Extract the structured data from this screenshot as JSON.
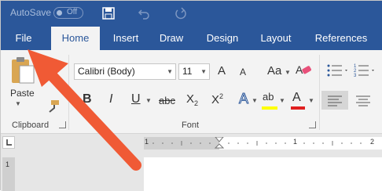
{
  "titlebar": {
    "autosave_label": "AutoSave",
    "autosave_state": "Off",
    "icons": [
      "save-icon",
      "undo-icon",
      "redo-icon"
    ]
  },
  "tabs": [
    {
      "label": "File",
      "active": false
    },
    {
      "label": "Home",
      "active": true
    },
    {
      "label": "Insert",
      "active": false
    },
    {
      "label": "Draw",
      "active": false
    },
    {
      "label": "Design",
      "active": false
    },
    {
      "label": "Layout",
      "active": false
    },
    {
      "label": "References",
      "active": false
    }
  ],
  "clipboard": {
    "paste_label": "Paste",
    "group_label": "Clipboard"
  },
  "font": {
    "font_name": "Calibri (Body)",
    "font_size": "11",
    "group_label": "Font",
    "grow_glyph": "A",
    "shrink_glyph": "A",
    "case_glyph": "Aa",
    "bold": "B",
    "italic": "I",
    "underline": "U",
    "strike": "abc",
    "subscript": "X",
    "subscript_mark": "2",
    "superscript": "X",
    "superscript_mark": "2",
    "effects_glyph": "A",
    "highlight_glyph": "ab",
    "fontcolor_glyph": "A"
  },
  "ruler": {
    "left_number": "1",
    "mid_number": "1",
    "right_number": "2",
    "vertical_number": "1"
  },
  "colors": {
    "brand": "#2b579a",
    "arrow": "#f05a35",
    "highlight": "#ffff00",
    "font_color": "#e02020"
  }
}
